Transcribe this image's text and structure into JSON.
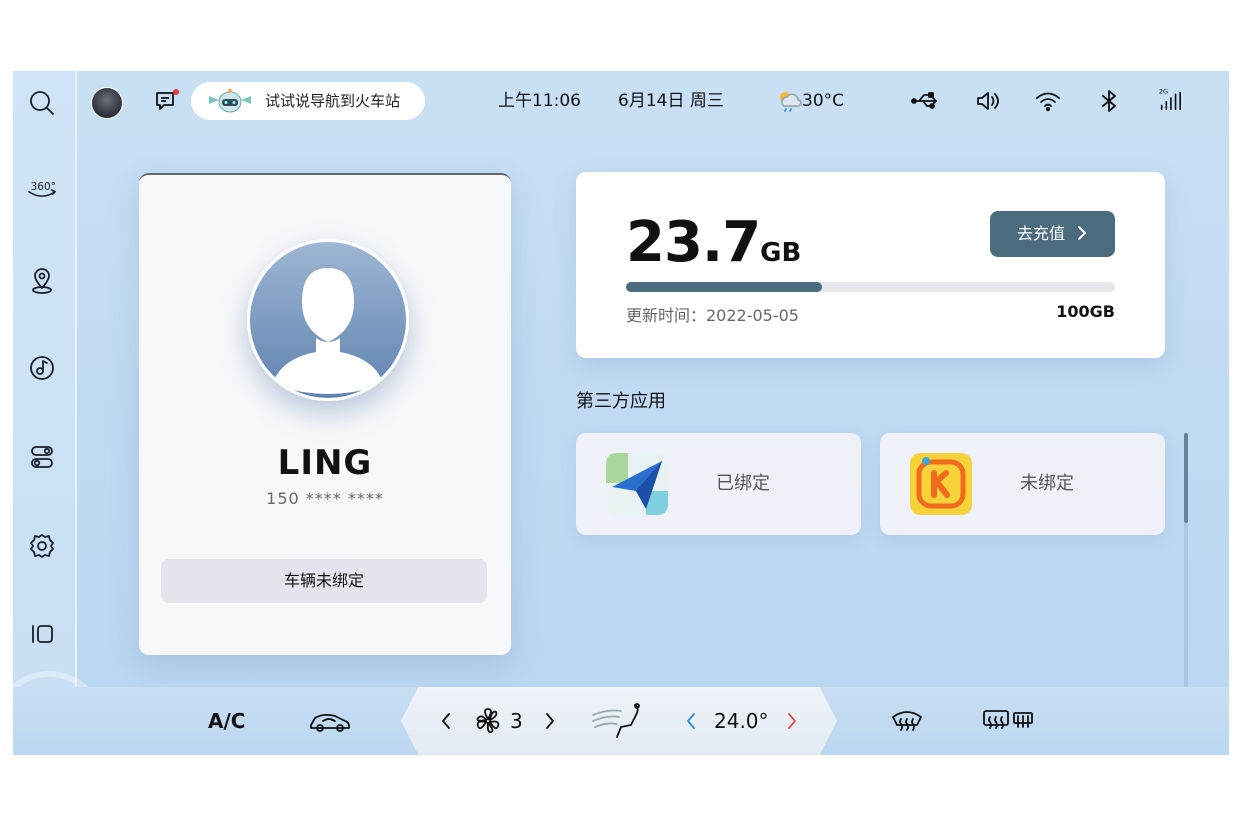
{
  "statusbar": {
    "voice_hint": "试试说导航到火车站",
    "time": "上午11:06",
    "date": "6月14日 周三",
    "temperature": "30°C",
    "signal_label": "2G"
  },
  "sidebar": {
    "items": [
      {
        "icon": "search-icon"
      },
      {
        "icon": "360-camera-icon",
        "label": "360°"
      },
      {
        "icon": "map-pin-icon"
      },
      {
        "icon": "music-icon"
      },
      {
        "icon": "toggle-controls-icon"
      },
      {
        "icon": "gear-icon"
      },
      {
        "icon": "panels-icon"
      }
    ]
  },
  "profile": {
    "name": "LING",
    "phone": "150 **** ****",
    "vehicle_button": "车辆未绑定"
  },
  "data_plan": {
    "remaining_value": "23.7",
    "remaining_unit": "GB",
    "recharge_label": "去充值",
    "update_text": "更新时间：2022-05-05",
    "total": "100GB",
    "used_fraction": 0.4,
    "fill_color": "#4b6b7e"
  },
  "third_party": {
    "title": "第三方应用",
    "apps": [
      {
        "icon": "navigation-app-icon",
        "status": "已绑定"
      },
      {
        "icon": "karaoke-app-icon",
        "status": "未绑定"
      }
    ]
  },
  "bottombar": {
    "ac_label": "A/C",
    "fan_level": "3",
    "temperature": "24.0°"
  },
  "colors": {
    "accent": "#4b6b7e",
    "left_arrow": "#2a8fd6",
    "right_arrow": "#e14b4b"
  }
}
